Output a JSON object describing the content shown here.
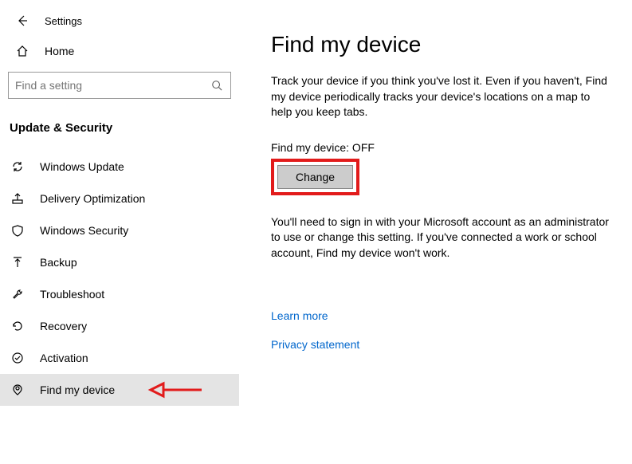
{
  "header": {
    "title": "Settings"
  },
  "home": {
    "label": "Home"
  },
  "search": {
    "placeholder": "Find a setting"
  },
  "group": {
    "title": "Update & Security"
  },
  "sidebar": {
    "items": [
      {
        "label": "Windows Update"
      },
      {
        "label": "Delivery Optimization"
      },
      {
        "label": "Windows Security"
      },
      {
        "label": "Backup"
      },
      {
        "label": "Troubleshoot"
      },
      {
        "label": "Recovery"
      },
      {
        "label": "Activation"
      },
      {
        "label": "Find my device"
      }
    ]
  },
  "main": {
    "title": "Find my device",
    "description": "Track your device if you think you've lost it. Even if you haven't, Find my device periodically tracks your device's locations on a map to help you keep tabs.",
    "status": "Find my device: OFF",
    "change_label": "Change",
    "note": "You'll need to sign in with your Microsoft account as an administrator to use or change this setting. If you've connected a work or school account, Find my device won't work.",
    "learn_more": "Learn more",
    "privacy": "Privacy statement"
  }
}
